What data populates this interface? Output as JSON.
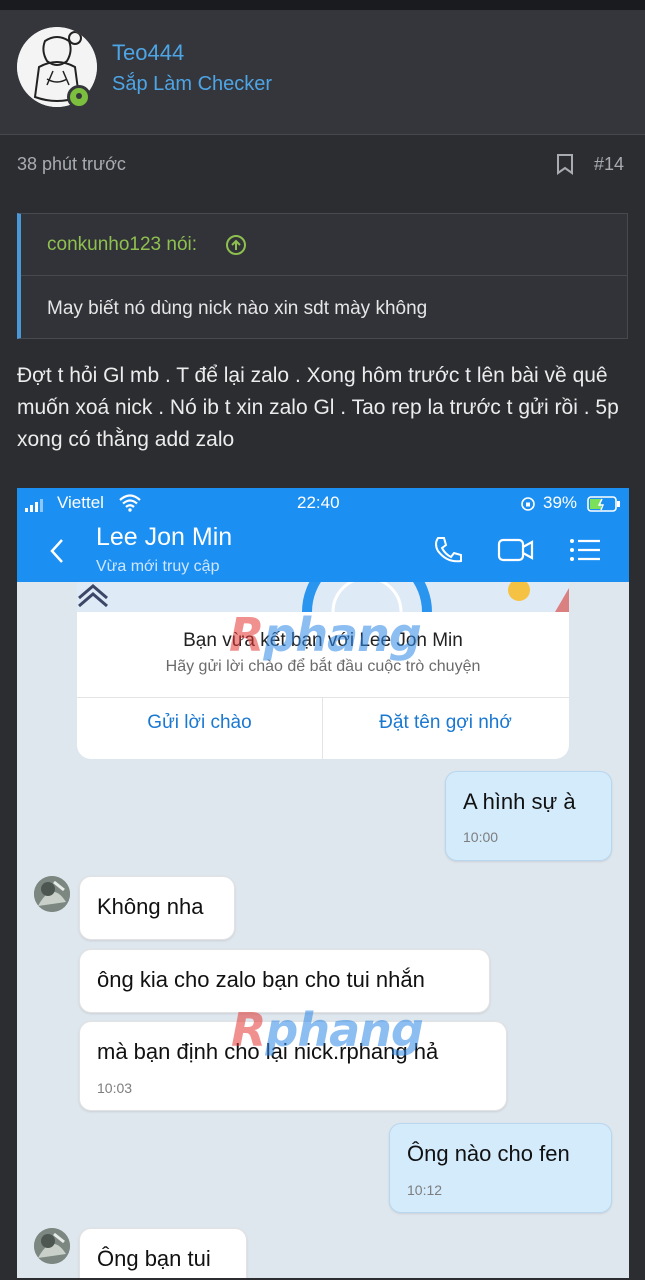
{
  "post": {
    "author": "Teo444",
    "author_title": "Sắp Làm Checker",
    "time": "38 phút trước",
    "post_number": "#14",
    "quote": {
      "author_line": "conkunho123 nói:",
      "text": "May biết nó dùng nick nào xin sdt mày không"
    },
    "body": "Đợt t hỏi Gl mb . T để lại zalo . Xong hôm trước t lên bài về quê muốn xoá nick . Nó ib t xin zalo Gl . Tao rep la trước t gửi rồi . 5p xong có thằng add zalo"
  },
  "screenshot": {
    "status": {
      "carrier": "Viettel",
      "time": "22:40",
      "battery": "39%"
    },
    "chat": {
      "name": "Lee Jon Min",
      "subtitle": "Vừa mới truy cập"
    },
    "card": {
      "title": "Bạn vừa kết bạn với Lee Jon Min",
      "subtitle": "Hãy gửi lời chào để bắt đầu cuộc trò chuyện",
      "left_button": "Gửi lời chào",
      "right_button": "Đặt tên gợi nhớ"
    },
    "messages": [
      {
        "text": "A hình sự à",
        "time": "10:00"
      },
      {
        "text": "Không nha",
        "time": ""
      },
      {
        "text": "ông kia cho zalo bạn cho tui nhắn",
        "time": ""
      },
      {
        "text": "mà bạn định cho lại nick.rphang hả",
        "time": "10:03"
      },
      {
        "text": "Ông nào cho fen",
        "time": "10:12"
      },
      {
        "text": "Ông bạn tui",
        "time": ""
      }
    ],
    "watermark": {
      "first": "R",
      "rest": "phang"
    }
  },
  "colors": {
    "background": "#2b2d31",
    "header": "#34363b",
    "link_blue": "#4ea5e6",
    "quote_green": "#8fc04f",
    "zalo_blue": "#1b8ff2",
    "watermark_red": "#e53935",
    "watermark_blue": "#2f8ae8"
  }
}
